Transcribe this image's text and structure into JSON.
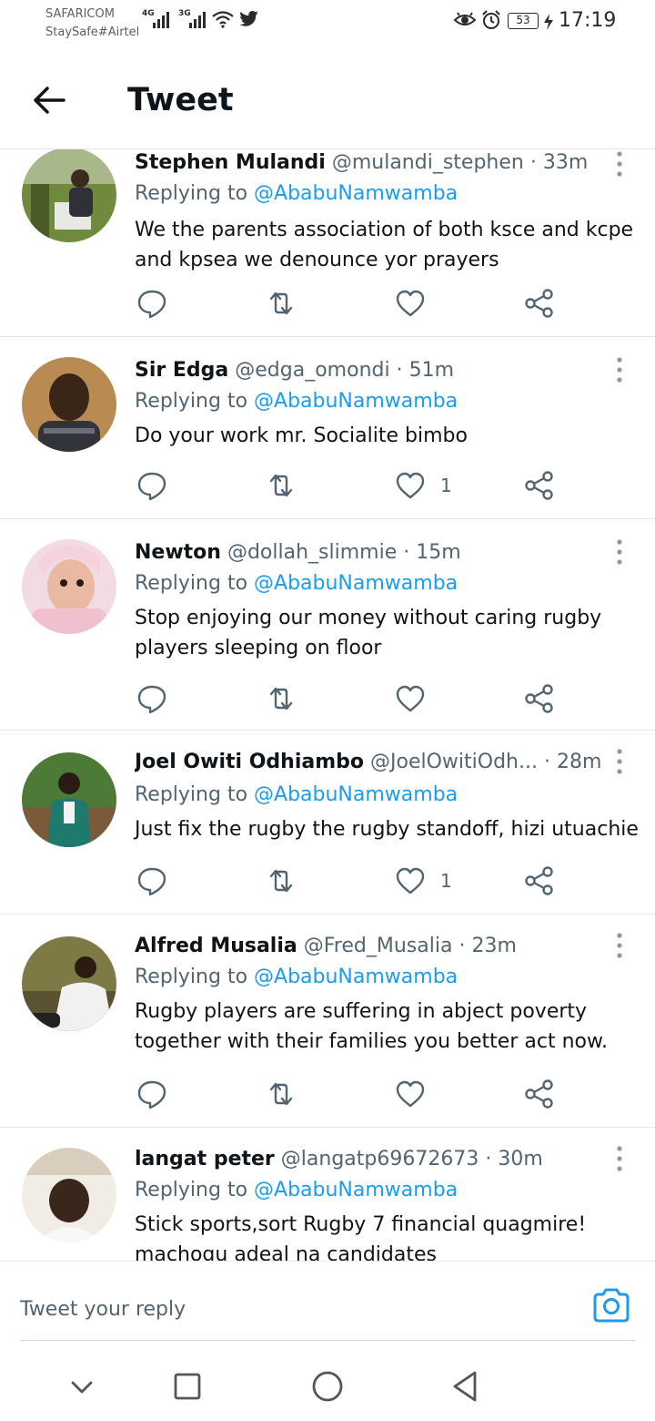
{
  "status_bar": {
    "carrier_1": "SAFARICOM",
    "carrier_2": "StaySafe#Airtel",
    "net_1": "4G",
    "net_2": "3G",
    "battery": "53",
    "time": "17:19"
  },
  "header": {
    "title": "Tweet"
  },
  "tweets": [
    {
      "name": "Stephen Mulandi",
      "handle": "@mulandi_stephen",
      "ago": "33m",
      "replying_label": "Replying to",
      "replying_to": "@AbabuNamwamba",
      "lines": [
        "We the parents association of both ksce and kcpe",
        "and kpsea we denounce yor prayers"
      ],
      "likes": ""
    },
    {
      "name": "Sir Edga",
      "handle": "@edga_omondi",
      "ago": "51m",
      "replying_label": "Replying to",
      "replying_to": "@AbabuNamwamba",
      "lines": [
        "Do your work mr. Socialite bimbo"
      ],
      "likes": "1"
    },
    {
      "name": "Newton",
      "handle": "@dollah_slimmie",
      "ago": "15m",
      "replying_label": "Replying to",
      "replying_to": "@AbabuNamwamba",
      "lines": [
        "Stop enjoying our money without caring rugby",
        "players sleeping on floor"
      ],
      "likes": ""
    },
    {
      "name": "Joel Owiti Odhiambo",
      "handle": "@JoelOwitiOdh...",
      "ago": "28m",
      "replying_label": "Replying to",
      "replying_to": "@AbabuNamwamba",
      "lines": [
        "Just fix the rugby the rugby standoff, hizi utuachie"
      ],
      "likes": "1"
    },
    {
      "name": "Alfred Musalia",
      "handle": "@Fred_Musalia",
      "ago": "23m",
      "replying_label": "Replying to",
      "replying_to": "@AbabuNamwamba",
      "lines": [
        "Rugby players are suffering in abject poverty",
        "together with their families you better act now."
      ],
      "likes": ""
    },
    {
      "name": "langat peter",
      "handle": "@langatp69672673",
      "ago": "30m",
      "replying_label": "Replying to",
      "replying_to": "@AbabuNamwamba",
      "lines": [
        "Stick sports,sort Rugby 7 financial quagmire!",
        "machogu adeal na candidates"
      ],
      "likes": ""
    }
  ],
  "compose": {
    "placeholder": "Tweet your reply"
  },
  "icons": {
    "back": "arrow-left-icon",
    "more": "more-vertical-icon",
    "reply": "reply-icon",
    "retweet": "retweet-icon",
    "like": "heart-icon",
    "share": "share-icon",
    "camera": "camera-icon",
    "nav_down": "chevron-down-icon",
    "nav_recents": "square-icon",
    "nav_home": "circle-icon",
    "nav_back": "triangle-back-icon"
  },
  "colors": {
    "accent": "#1d9bf0",
    "text": "#0f1419",
    "secondary": "#536471",
    "divider": "#e6e9ec"
  }
}
